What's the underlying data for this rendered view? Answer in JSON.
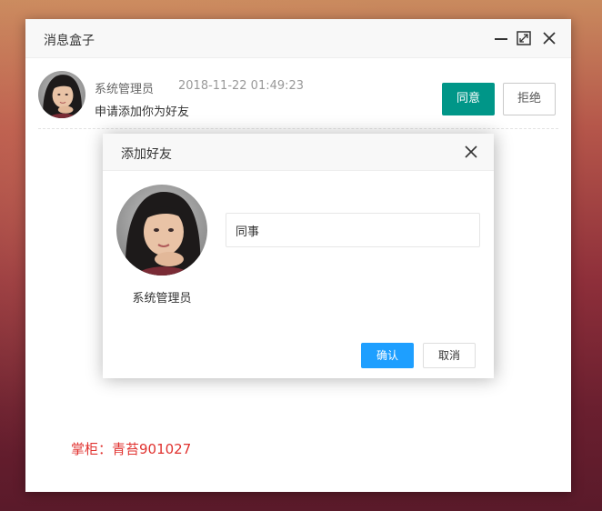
{
  "window": {
    "title": "消息盒子"
  },
  "message": {
    "sender": "系统管理员",
    "time": "2018-11-22 01:49:23",
    "text": "申请添加你为好友",
    "agree_label": "同意",
    "reject_label": "拒绝"
  },
  "dialog": {
    "title": "添加好友",
    "user_name": "系统管理员",
    "remark_value": "同事",
    "ok_label": "确认",
    "cancel_label": "取消"
  },
  "footer_note": "掌柜：青苔901027",
  "colors": {
    "agree": "#009688",
    "ok": "#1e9fff",
    "note": "#e0322f"
  }
}
